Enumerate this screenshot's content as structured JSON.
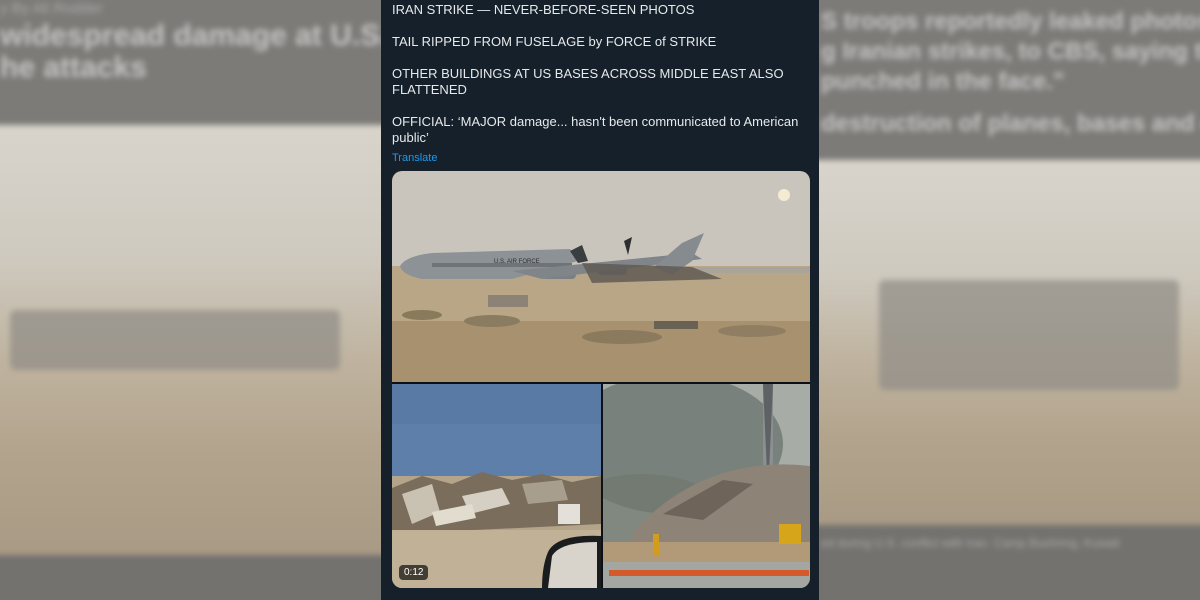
{
  "tweet": {
    "lines": [
      "IRAN STRIKE — NEVER-BEFORE-SEEN PHOTOS",
      "TAIL RIPPED FROM FUSELAGE by FORCE of STRIKE",
      "OTHER BUILDINGS AT US BASES ACROSS MIDDLE EAST ALSO",
      "FLATTENED",
      "OFFICIAL: ‘MAJOR damage... hasn't been communicated to American",
      "public’"
    ],
    "translate_label": "Translate",
    "video_duration": "0:12",
    "aircraft_marking": "U.S. AIR FORCE"
  },
  "background": {
    "byline": "y By Ali Rodder",
    "headline_line1": "widespread damage at U.S. pos",
    "headline_line2": "he attacks",
    "right_line1": "S troops reportedly leaked photos of t",
    "right_line2": "g Iranian strikes, to CBS, saying they're",
    "right_line3": "punched in the face.\"",
    "right_line4": "destruction of planes, bases and othe",
    "caption": "ed during U.S. conflict with Iran. Camp Buehring, Kuwait"
  },
  "colors": {
    "card_bg": "#15202b",
    "text": "#e7e9ea",
    "link": "#1d9bf0"
  }
}
